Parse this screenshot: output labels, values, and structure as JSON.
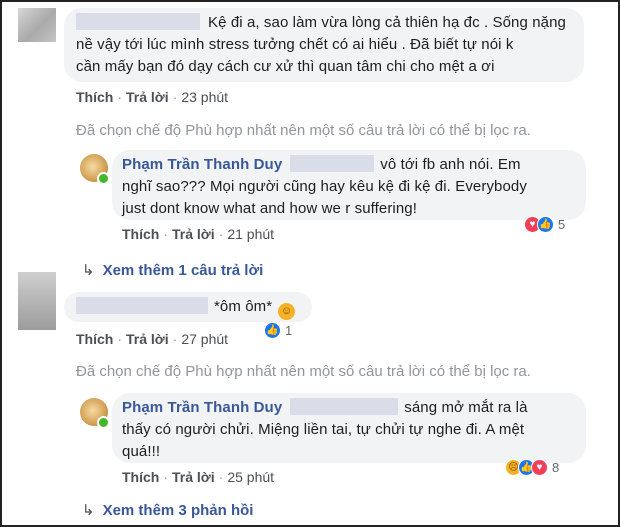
{
  "comments": [
    {
      "text": "Kệ đi a, sao làm vừa lòng cả thiên hạ đc . Sống nặng nề vậy tới lúc mình stress tưởng chết có ai hiểu . Đã biết tự nói k cần mấy bạn đó dạy cách cư xử thì quan tâm chi cho mệt a ơi",
      "line1": "Kệ đi a, sao làm vừa lòng cả thiên hạ đc . Sống nặng",
      "line2": "nề vậy tới lúc mình stress tưởng chết có ai hiểu . Đã biết tự nói k",
      "line3": "cần mấy bạn đó dạy cách cư xử thì quan tâm chi cho mệt a ơi",
      "like": "Thích",
      "reply": "Trả lời",
      "time": "23 phút"
    },
    {
      "line1": "*ôm ôm*",
      "emoji": "hugging-face",
      "like": "Thích",
      "reply": "Trả lời",
      "time": "27 phút",
      "reaction_count": "1",
      "reactions": [
        "like"
      ]
    }
  ],
  "notice": "Đã chọn chế độ Phù hợp nhất nên một số câu trả lời có thể bị lọc ra.",
  "replies": [
    {
      "author": "Phạm Trần Thanh Duy",
      "line1_tail": "vô tới fb anh nói. Em",
      "line2": "nghĩ sao??? Mọi người cũng hay kêu kệ đi kệ đi. Everybody",
      "line3": "just dont know what and how we r suffering!",
      "like": "Thích",
      "reply": "Trả lời",
      "time": "21 phút",
      "reaction_count": "5",
      "reactions": [
        "love",
        "like"
      ]
    },
    {
      "author": "Phạm Trần Thanh Duy",
      "line1_tail": "sáng mở mắt ra là",
      "line2": "thấy có người chửi. Miệng liền tai, tự chửi tự nghe đi. A mệt",
      "line3": "quá!!!",
      "like": "Thích",
      "reply": "Trả lời",
      "time": "25 phút",
      "reaction_count": "8",
      "reactions": [
        "sad",
        "like",
        "love"
      ]
    }
  ],
  "more": [
    {
      "label": "Xem thêm 1 câu trả lời"
    },
    {
      "label": "Xem thêm 3 phản hồi"
    }
  ],
  "colors": {
    "link": "#385898",
    "bubble": "#f2f3f5",
    "muted": "#90949c",
    "online": "#42b72a"
  }
}
